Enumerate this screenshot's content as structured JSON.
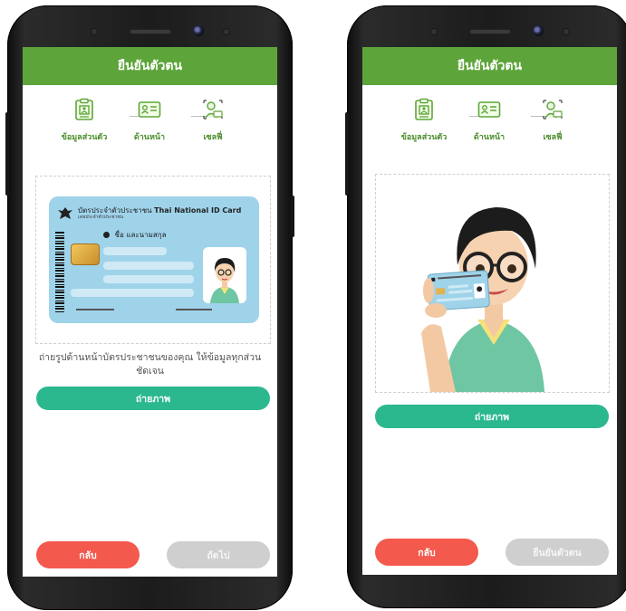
{
  "colors": {
    "header_green": "#5da53a",
    "step_green": "#4a8d2a",
    "capture_teal": "#2cb88e",
    "back_red": "#f3594c",
    "disabled_gray": "#cfcfcf"
  },
  "left_screen": {
    "title": "ยืนยันตัวตน",
    "steps": [
      {
        "label": "ข้อมูลส่วนตัว",
        "icon": "id-document-icon"
      },
      {
        "label": "ด้านหน้า",
        "icon": "id-card-front-icon"
      },
      {
        "label": "เซลฟี่",
        "icon": "selfie-with-card-icon"
      }
    ],
    "id_card": {
      "title_th": "บัตรประจำตัวประชาชน",
      "title_en": "Thai National ID Card",
      "subtitle": "เลขประจำตัวประชาชน",
      "name_label": "ชื่อ และนามสกุล"
    },
    "instruction": "ถ่ายรูปด้านหน้าบัตรประชาชนของคุณ ให้ข้อมูลทุกส่วนชัดเจน",
    "capture_label": "ถ่ายภาพ",
    "back_label": "กลับ",
    "next_label": "ถัดไป"
  },
  "right_screen": {
    "title": "ยืนยันตัวตน",
    "steps": [
      {
        "label": "ข้อมูลส่วนตัว",
        "icon": "id-document-icon"
      },
      {
        "label": "ด้านหน้า",
        "icon": "id-card-front-icon"
      },
      {
        "label": "เซลฟี่",
        "icon": "selfie-with-card-icon"
      }
    ],
    "capture_label": "ถ่ายภาพ",
    "back_label": "กลับ",
    "confirm_label": "ยืนยันตัวตน"
  }
}
